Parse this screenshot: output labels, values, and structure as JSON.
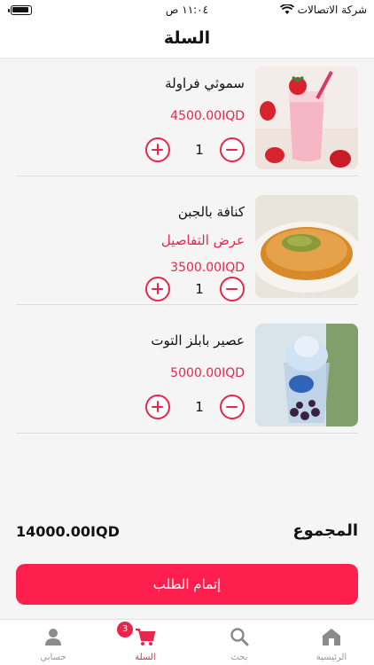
{
  "status_bar": {
    "carrier": "شركة الاتصالات",
    "time": "١١:٠٤ ص"
  },
  "header": {
    "title": "السلة"
  },
  "cart": {
    "items": [
      {
        "name": "سموثي فراولة",
        "price": "4500.00IQD",
        "quantity": "1",
        "details_link": "",
        "image": "strawberry-smoothie"
      },
      {
        "name": "كنافة بالجبن",
        "price": "3500.00IQD",
        "quantity": "1",
        "details_link": "عرض التفاصيل",
        "image": "cheese-kunafa"
      },
      {
        "name": "عصير بابلز التوت",
        "price": "5000.00IQD",
        "quantity": "1",
        "details_link": "",
        "image": "berry-bubble-juice"
      }
    ]
  },
  "summary": {
    "total_label": "المجموع",
    "total_value": "14000.00IQD"
  },
  "checkout": {
    "label": "إتمام الطلب"
  },
  "tab_bar": {
    "tabs": [
      {
        "label": "الرئيسية",
        "icon": "home-icon"
      },
      {
        "label": "بحث",
        "icon": "search-icon"
      },
      {
        "label": "السلة",
        "icon": "cart-icon",
        "badge": "3"
      },
      {
        "label": "حسابي",
        "icon": "person-icon"
      }
    ]
  },
  "colors": {
    "accent": "#e8264b",
    "button": "#ff1f4f"
  }
}
